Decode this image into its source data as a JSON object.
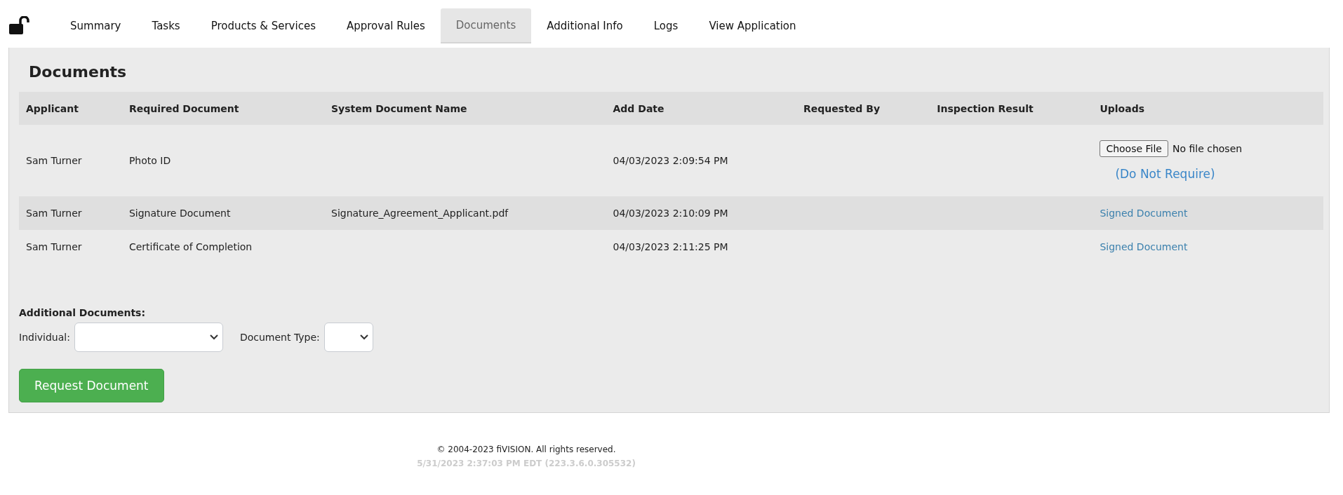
{
  "tabs": [
    {
      "label": "Summary",
      "selected": false
    },
    {
      "label": "Tasks",
      "selected": false
    },
    {
      "label": "Products & Services",
      "selected": false
    },
    {
      "label": "Approval Rules",
      "selected": false
    },
    {
      "label": "Documents",
      "selected": true
    },
    {
      "label": "Additional Info",
      "selected": false
    },
    {
      "label": "Logs",
      "selected": false
    },
    {
      "label": "View Application",
      "selected": false
    }
  ],
  "panel": {
    "title": "Documents",
    "table": {
      "columns": [
        "Applicant",
        "Required Document",
        "System Document Name",
        "Add Date",
        "Requested By",
        "Inspection Result",
        "Uploads"
      ],
      "rows": [
        {
          "applicant": "Sam Turner",
          "required_document": "Photo ID",
          "system_document_name": "",
          "add_date": "04/03/2023 2:09:54 PM",
          "uploads": {
            "kind": "file",
            "button": "Choose File",
            "status": "No file chosen",
            "link": "(Do Not Require)"
          }
        },
        {
          "applicant": "Sam Turner",
          "required_document": "Signature Document",
          "system_document_name": "Signature_Agreement_Applicant.pdf",
          "add_date": "04/03/2023 2:10:09 PM",
          "uploads": {
            "kind": "link",
            "link": "Signed Document"
          }
        },
        {
          "applicant": "Sam Turner",
          "required_document": "Certificate of Completion",
          "system_document_name": "",
          "add_date": "04/03/2023 2:11:25 PM",
          "uploads": {
            "kind": "link",
            "link": "Signed Document"
          }
        }
      ]
    },
    "additional": {
      "heading": "Additional Documents:",
      "individual_label": "Individual:",
      "document_type_label": "Document Type:"
    },
    "request_button": "Request Document"
  },
  "footer": {
    "copyright": "© 2004-2023 fiVISION. All rights reserved.",
    "version": "5/31/2023 2:37:03 PM EDT (223.3.6.0.305532)"
  }
}
